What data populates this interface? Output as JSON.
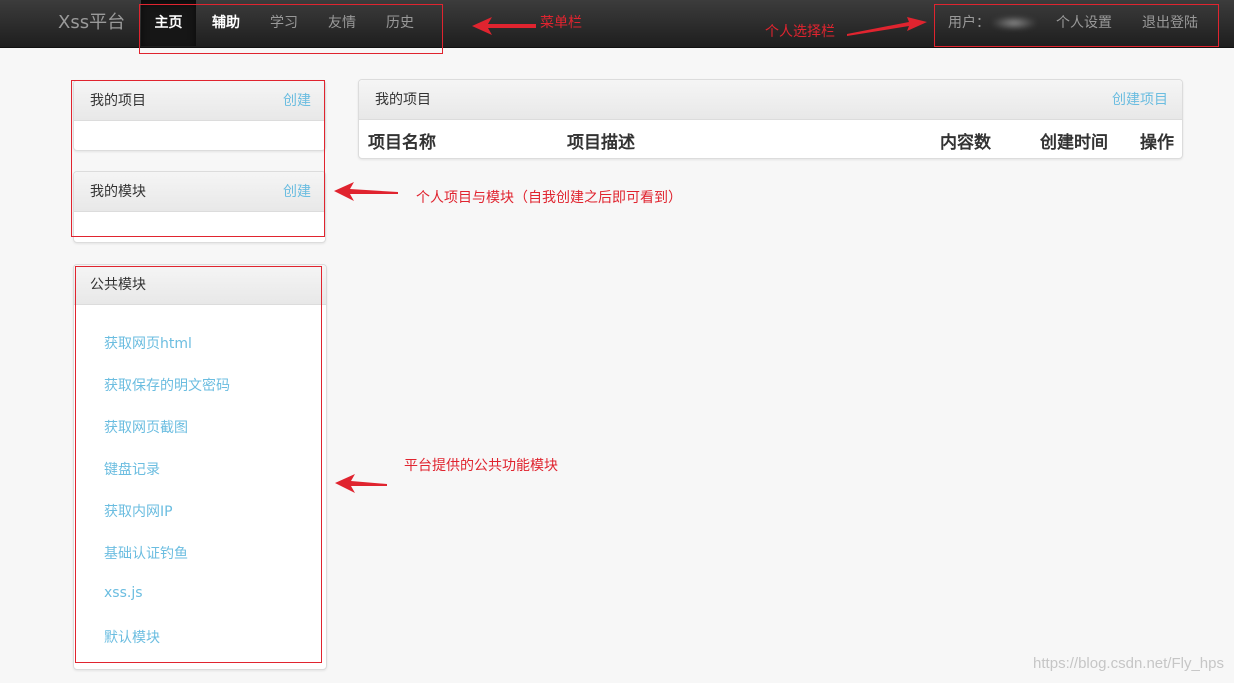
{
  "navbar": {
    "brand": "Xss平台",
    "menu": [
      {
        "label": "主页"
      },
      {
        "label": "辅助"
      },
      {
        "label": "学习"
      },
      {
        "label": "友情"
      },
      {
        "label": "历史"
      }
    ],
    "user_label": "用户：",
    "settings_label": "个人设置",
    "logout_label": "退出登陆"
  },
  "sidebar": {
    "my_projects": {
      "title": "我的项目",
      "action": "创建"
    },
    "my_modules": {
      "title": "我的模块",
      "action": "创建"
    },
    "public_modules": {
      "title": "公共模块",
      "items": [
        {
          "label": "获取网页html"
        },
        {
          "label": "获取保存的明文密码"
        },
        {
          "label": "获取网页截图"
        },
        {
          "label": "键盘记录"
        },
        {
          "label": "获取内网IP"
        },
        {
          "label": "基础认证钓鱼"
        },
        {
          "label": "xss.js"
        },
        {
          "label": "默认模块"
        }
      ]
    }
  },
  "main": {
    "title": "我的项目",
    "action": "创建项目",
    "columns": [
      "项目名称",
      "项目描述",
      "内容数",
      "创建时间",
      "操作"
    ]
  },
  "annotations": {
    "menu_bar": "菜单栏",
    "personal_bar": "个人选择栏",
    "personal_projects": "个人项目与模块（自我创建之后即可看到）",
    "public_modules": "平台提供的公共功能模块"
  },
  "watermark": "https://blog.csdn.net/Fly_hps",
  "colors": {
    "link": "#6bbde0",
    "annotation": "#e0242f",
    "navbar_bg": "#2a2a2a"
  }
}
